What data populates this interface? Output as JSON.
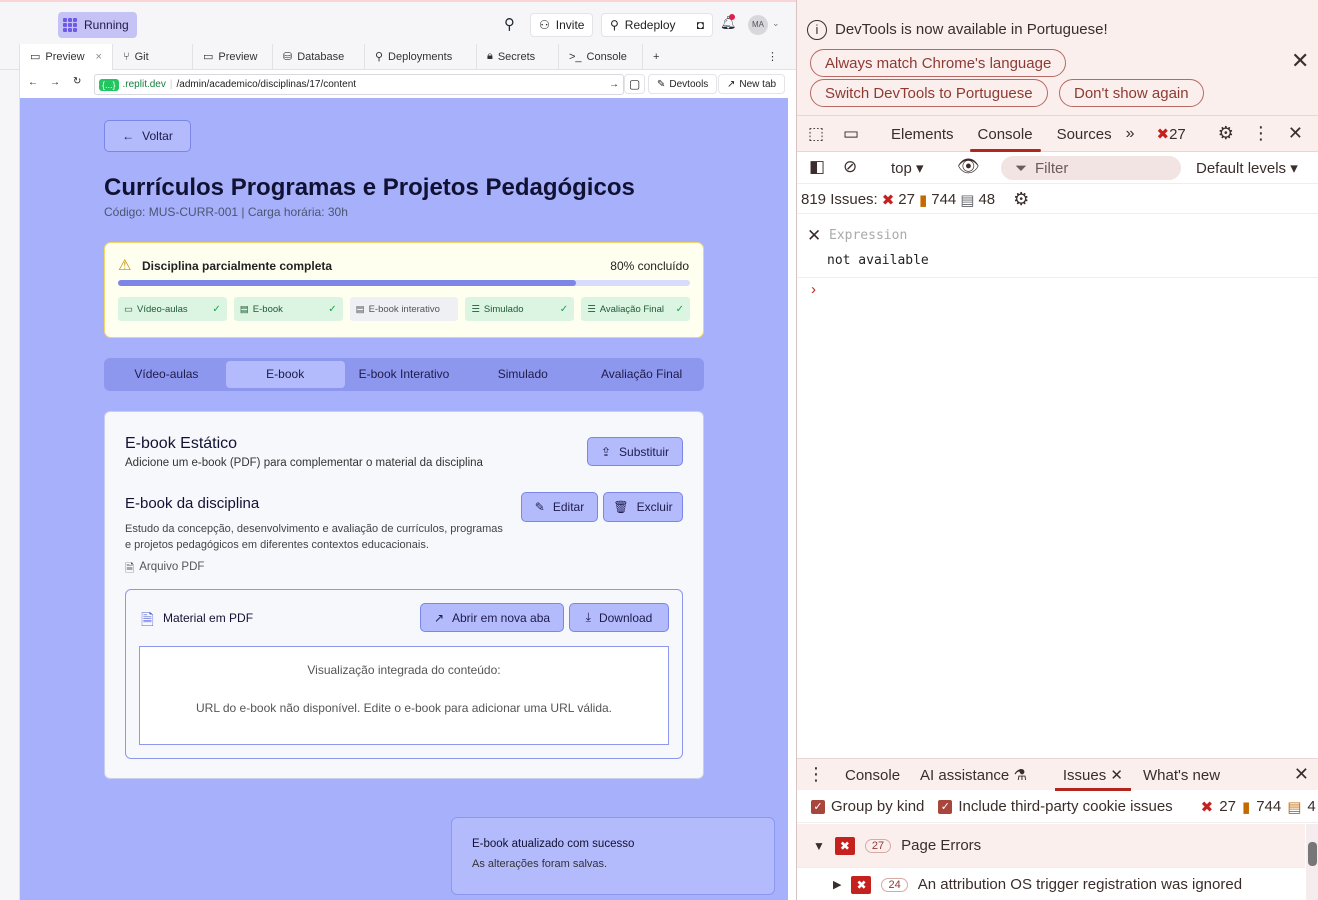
{
  "replit": {
    "status": "Running",
    "invite": "Invite",
    "redeploy": "Redeploy",
    "avatar": "MA",
    "tabs": [
      "Preview",
      "Git",
      "Preview",
      "Database",
      "Deployments",
      "Secrets",
      "Console"
    ],
    "url_domain": ".replit.dev",
    "url_path": "/admin/academico/disciplinas/17/content",
    "devtools_btn": "Devtools",
    "newtab_btn": "New tab"
  },
  "app": {
    "back": "Voltar",
    "title": "Currículos Programas e Projetos Pedagógicos",
    "subtitle": "Código: MUS-CURR-001 | Carga horária: 30h",
    "progress": {
      "label": "Disciplina parcialmente completa",
      "percent_text": "80% concluído",
      "fraction": 0.8,
      "items": [
        {
          "label": "Vídeo-aulas",
          "done": true
        },
        {
          "label": "E-book",
          "done": true
        },
        {
          "label": "E-book interativo",
          "done": false
        },
        {
          "label": "Simulado",
          "done": true
        },
        {
          "label": "Avaliação Final",
          "done": true
        }
      ]
    },
    "tabs": [
      "Vídeo-aulas",
      "E-book",
      "E-book Interativo",
      "Simulado",
      "Avaliação Final"
    ],
    "selected_tab": 1,
    "ebook": {
      "heading": "E-book Estático",
      "description": "Adicione um e-book (PDF) para complementar o material da disciplina",
      "replace": "Substituir",
      "item_title": "E-book da disciplina",
      "item_desc_1": "Estudo da concepção, desenvolvimento e avaliação de currículos, programas",
      "item_desc_2": "e projetos pedagógicos em diferentes contextos educacionais.",
      "file_type": "Arquivo PDF",
      "edit": "Editar",
      "delete": "Excluir",
      "pdf_title": "Material em PDF",
      "open_new": "Abrir em nova aba",
      "download": "Download",
      "viewer_caption": "Visualização integrada do conteúdo:",
      "viewer_msg": "URL do e-book não disponível. Edite o e-book para adicionar uma URL válida."
    },
    "toast": {
      "title": "E-book atualizado com sucesso",
      "body": "As alterações foram salvas."
    }
  },
  "devtools": {
    "banner": "DevTools is now available in Portuguese!",
    "b1": "Always match Chrome's language",
    "b2": "Switch DevTools to Portuguese",
    "b3": "Don't show again",
    "tabs": [
      "Elements",
      "Console",
      "Sources"
    ],
    "err_count": "27",
    "context": "top",
    "filter": "Filter",
    "levels": "Default levels",
    "issues_label": "819 Issues:",
    "issues_err": "27",
    "issues_warn": "744",
    "issues_info": "48",
    "expression_ph": "Expression",
    "expression_val": "not available",
    "drawer_tabs": [
      "Console",
      "AI assistance",
      "Issues",
      "What's new"
    ],
    "group_by_kind": "Group by kind",
    "third_party": "Include third-party cookie issues",
    "drawer_err": "27",
    "drawer_warn": "744",
    "drawer_info": "4",
    "page_errors_count": "27",
    "page_errors": "Page Errors",
    "attr_count": "24",
    "attr_msg": "An attribution OS trigger registration was ignored"
  },
  "colors": {
    "accent": "#a7b1fb",
    "devtools_accent": "#b3261e",
    "success": "#16a34a"
  }
}
